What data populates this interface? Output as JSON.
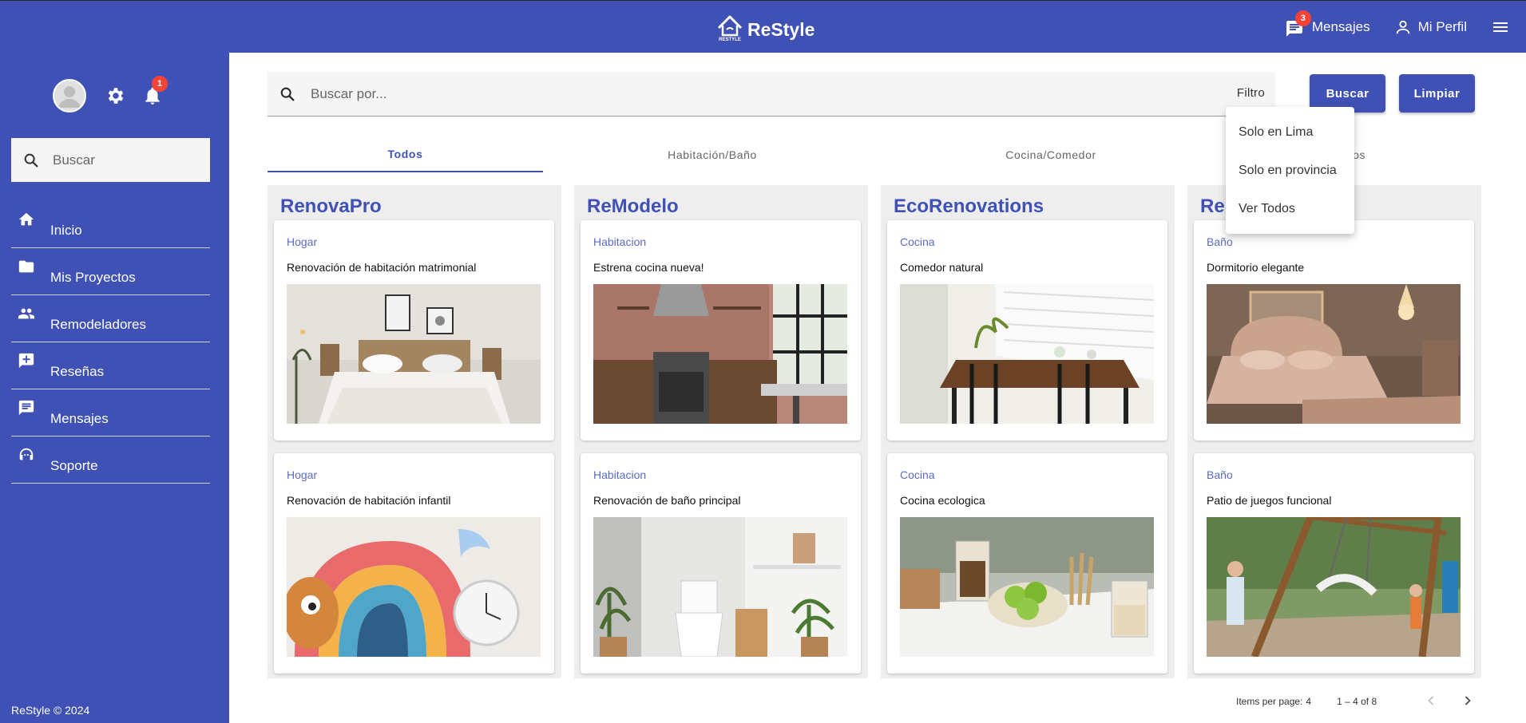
{
  "header": {
    "brand_name": "ReStyle",
    "logo_text": "RESTYLE",
    "messages_label": "Mensajes",
    "messages_badge": "3",
    "profile_label": "Mi Perfil"
  },
  "sidebar": {
    "notifications_badge": "1",
    "search_placeholder": "Buscar",
    "items": [
      {
        "label": "Inicio",
        "icon": "home-icon"
      },
      {
        "label": "Mis Proyectos",
        "icon": "folder-icon"
      },
      {
        "label": "Remodeladores",
        "icon": "people-icon"
      },
      {
        "label": "Reseñas",
        "icon": "review-icon"
      },
      {
        "label": "Mensajes",
        "icon": "chat-icon"
      },
      {
        "label": "Soporte",
        "icon": "support-icon"
      }
    ],
    "footer": "ReStyle © 2024"
  },
  "search": {
    "placeholder": "Buscar por...",
    "filter_label": "Filtro",
    "buscar_button": "Buscar",
    "limpiar_button": "Limpiar"
  },
  "filter_menu": {
    "options": [
      "Solo en Lima",
      "Solo en provincia",
      "Ver Todos"
    ]
  },
  "tabs": [
    {
      "label": "Todos"
    },
    {
      "label": "Habitación/Baño"
    },
    {
      "label": "Cocina/Comedor"
    },
    {
      "label": "Otros"
    }
  ],
  "columns": [
    {
      "title": "RenovaPro",
      "cards": [
        {
          "category": "Hogar",
          "title": "Renovación de habitación matrimonial"
        },
        {
          "category": "Hogar",
          "title": "Renovación de habitación infantil"
        }
      ]
    },
    {
      "title": "ReModelo",
      "cards": [
        {
          "category": "Habitacion",
          "title": "Estrena cocina nueva!"
        },
        {
          "category": "Habitacion",
          "title": "Renovación de baño principal"
        }
      ]
    },
    {
      "title": "EcoRenovations",
      "cards": [
        {
          "category": "Cocina",
          "title": "Comedor natural"
        },
        {
          "category": "Cocina",
          "title": "Cocina ecologica"
        }
      ]
    },
    {
      "title": "Re",
      "cards": [
        {
          "category": "Baño",
          "title": "Dormitorio elegante"
        },
        {
          "category": "Baño",
          "title": "Patio de juegos funcional"
        }
      ]
    }
  ],
  "paginator": {
    "items_per_page_label": "Items per page:",
    "items_per_page_value": "4",
    "range": "1 – 4 of 8"
  },
  "colors": {
    "primary": "#3f51b5",
    "badge": "#f44336"
  }
}
